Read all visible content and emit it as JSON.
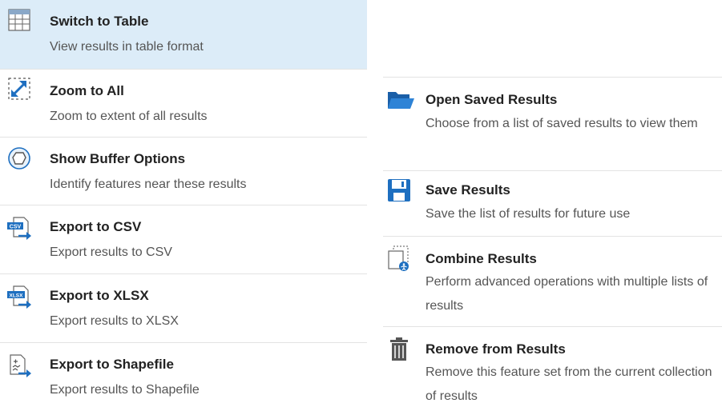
{
  "left_menu": [
    {
      "title": "Switch to Table",
      "description": "View results in table format",
      "icon": "table-icon"
    },
    {
      "title": "Zoom to All",
      "description": "Zoom to extent of all results",
      "icon": "zoom-extent-icon"
    },
    {
      "title": "Show Buffer Options",
      "description": "Identify features near these results",
      "icon": "buffer-icon"
    },
    {
      "title": "Export to CSV",
      "description": "Export results to CSV",
      "icon": "csv-export-icon",
      "badge": "CSV"
    },
    {
      "title": "Export to XLSX",
      "description": "Export results to XLSX",
      "icon": "xlsx-export-icon",
      "badge": "XLSX"
    },
    {
      "title": "Export to Shapefile",
      "description": "Export results to Shapefile",
      "icon": "shapefile-export-icon"
    }
  ],
  "right_menu": [
    {
      "title": "Open Saved Results",
      "description": "Choose from a list of saved results to view them",
      "icon": "folder-open-icon"
    },
    {
      "title": "Save Results",
      "description": "Save the list of results for future use",
      "icon": "save-icon"
    },
    {
      "title": "Combine Results",
      "description": "Perform advanced operations with multiple lists of results",
      "icon": "combine-icon"
    },
    {
      "title": "Remove from Results",
      "description": "Remove this feature set from the current collection of results",
      "icon": "trash-icon"
    }
  ],
  "colors": {
    "selected_bg": "#dcecf8",
    "accent": "#1e6fc0",
    "separator": "#e3e3e3"
  }
}
